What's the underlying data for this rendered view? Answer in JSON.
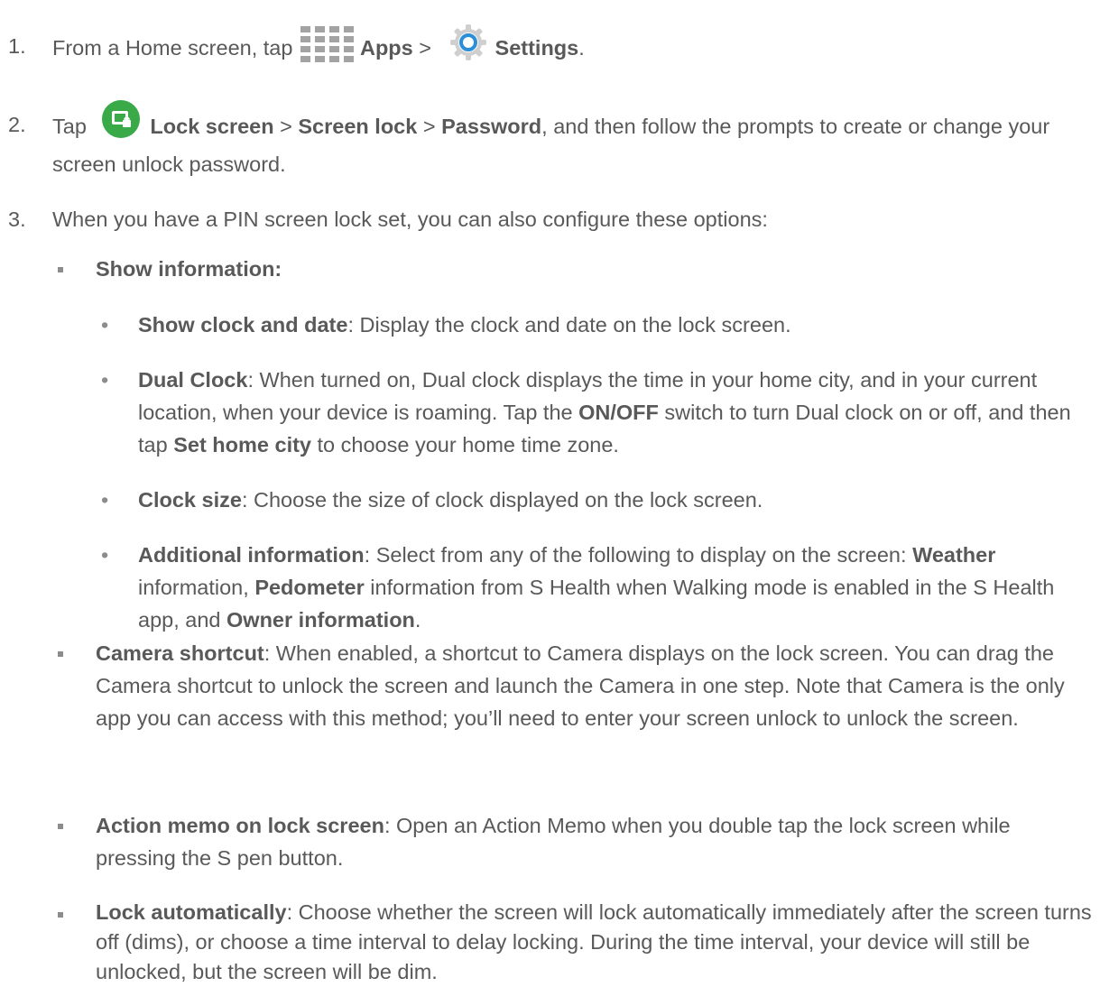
{
  "step1": {
    "num": "1.",
    "t1": "From a Home screen, tap ",
    "apps": "Apps",
    "gt": " > ",
    "settings": "Settings",
    "end": "."
  },
  "step2": {
    "num": "2.",
    "t1": "Tap ",
    "lock_screen": "Lock screen",
    "gt1": " > ",
    "screen_lock": "Screen lock",
    "gt2": " > ",
    "password": "Password",
    "rest": ", and then follow the prompts to create or change your screen unlock password."
  },
  "step3": {
    "num": "3.",
    "text": "When you have a PIN screen lock set, you can also configure these options:"
  },
  "show_info": {
    "label": "Show information:"
  },
  "clock_date": {
    "label": "Show clock and date",
    "text": ": Display the clock and date on the lock screen."
  },
  "dual_clock": {
    "label": "Dual Clock",
    "t1": ": When turned on, Dual clock displays the time in your home city, and in your current location, when your device is roaming. Tap the ",
    "onoff": "ON/OFF",
    "t2": " switch to turn Dual clock on or off, and then tap ",
    "set_home": "Set home city",
    "t3": " to choose your home time zone."
  },
  "clock_size": {
    "label": "Clock size",
    "text": ": Choose the size of clock displayed on the lock screen."
  },
  "additional": {
    "label": "Additional information",
    "t1": ": Select from any of the following to display on the screen: ",
    "weather": "Weather",
    "t2": " information, ",
    "pedometer": "Pedometer",
    "t3": " information from S Health when Walking mode is enabled in the S Health app, and ",
    "owner": "Owner information",
    "t4": "."
  },
  "camera": {
    "label": "Camera shortcut",
    "text": ": When enabled, a shortcut to Camera displays on the lock screen. You can drag the Camera shortcut to unlock the screen and launch the Camera in one step. Note that Camera is the only app you can access with this method; you’ll need to enter your screen unlock to unlock the screen."
  },
  "action_memo": {
    "label": "Action memo on lock screen",
    "text": ": Open an Action Memo when you double tap the lock screen while pressing the S pen button."
  },
  "lock_auto": {
    "label": "Lock automatically",
    "text": ": Choose whether the screen will lock automatically immediately after the screen turns off (dims), or choose a time interval to delay locking. During the time interval, your device will still be unlocked, but the screen will be dim."
  },
  "icons": {
    "apps": "apps-grid-icon",
    "settings": "settings-gear-icon",
    "lock_screen": "lock-screen-icon"
  },
  "colors": {
    "text": "#595959",
    "bullet": "#8c8c8c",
    "lock_icon_green": "#3aaa48",
    "gear_blue": "#2a8fd8"
  }
}
